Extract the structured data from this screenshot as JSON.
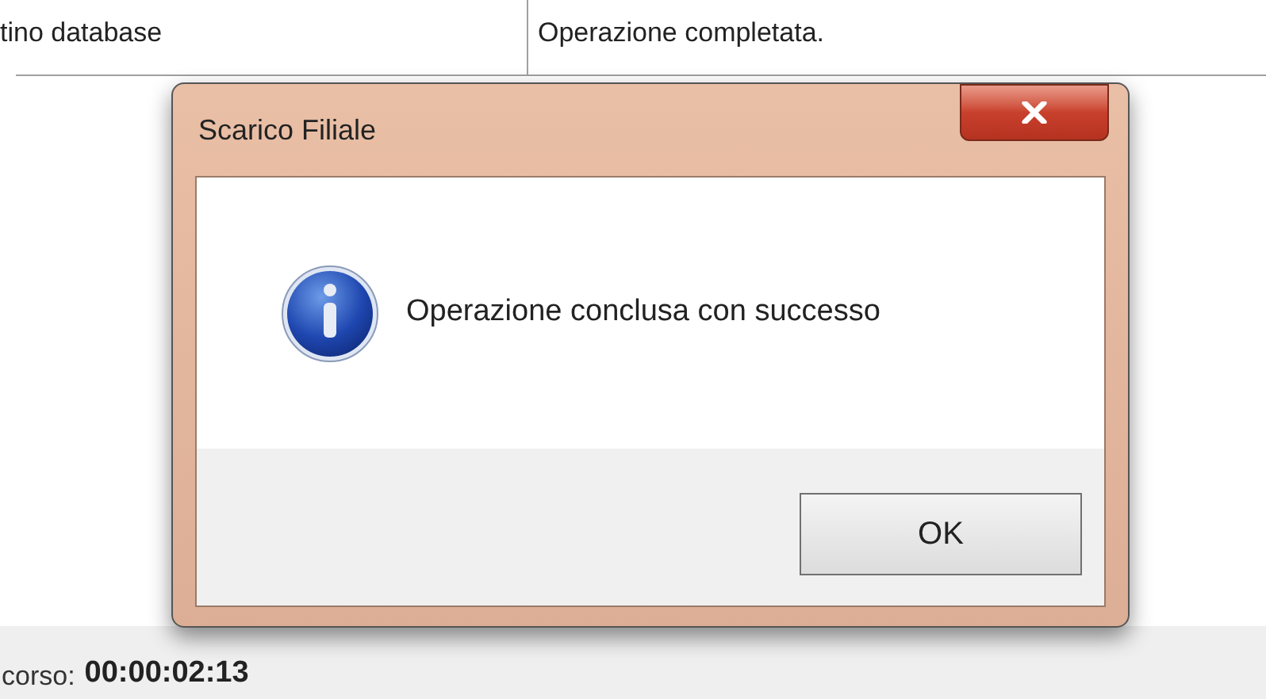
{
  "table": {
    "row": {
      "cells": [
        "tino database",
        "Operazione completata."
      ]
    }
  },
  "dialog": {
    "title": "Scarico Filiale",
    "message": "Operazione conclusa con successo",
    "buttons": [
      "OK"
    ]
  },
  "status_bar": {
    "label": "corso:",
    "value": "00:00:02:13"
  }
}
